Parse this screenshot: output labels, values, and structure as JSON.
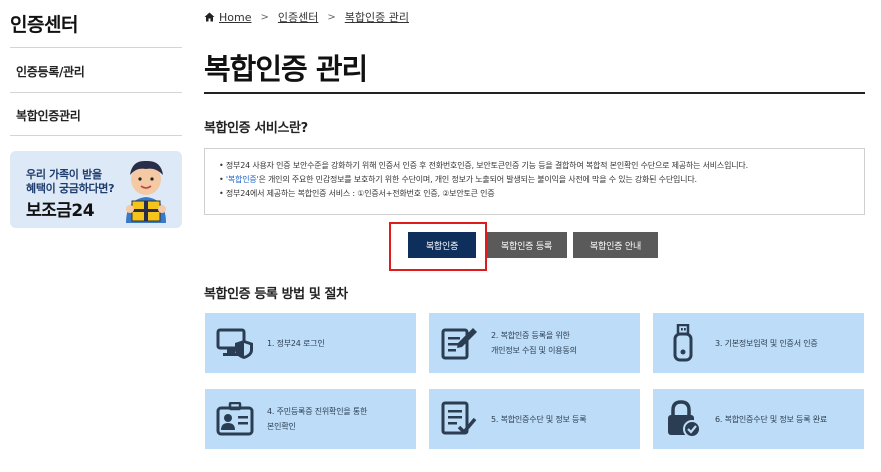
{
  "sidebar": {
    "title": "인증센터",
    "items": [
      {
        "label": "인증등록/관리"
      },
      {
        "label": "복합인증관리"
      }
    ],
    "banner": {
      "line1": "우리 가족이 받을",
      "line2": "혜택이 궁금하다면?",
      "brand": "보조금24"
    }
  },
  "breadcrumb": {
    "home": "Home",
    "level1": "인증센터",
    "level2": "복합인증 관리"
  },
  "page_title": "복합인증 관리",
  "service_section": {
    "title": "복합인증 서비스란?",
    "bullets": [
      {
        "pre": "",
        "highlight": "",
        "text": "정부24 사용자 인증 보안수준을 강화하기 위해 인증서 인증 후 전화번호인증, 보안토큰인증 기능 등을 결합하여 복합적 본인확인 수단으로 제공하는 서비스입니다."
      },
      {
        "pre": "",
        "highlight": "'복합인증'",
        "text": "은 개인의 주요한 민감정보를 보호하기 위한 수단이며, 개인 정보가 노출되어 발생되는 불이익을 사전에 막을 수 있는 강화된 수단입니다."
      },
      {
        "pre": "",
        "highlight": "",
        "text": "정부24에서 제공하는 복합인증 서비스 : ①인증서+전화번호 인증, ②보안토큰 인증"
      }
    ]
  },
  "buttons": {
    "primary": "복합인증",
    "register": "복합인증 등록",
    "guide": "복합인증 안내"
  },
  "procedure_section": {
    "title": "복합인증 등록 방법 및 절차",
    "steps": [
      {
        "line1": "1. 정부24 로그인",
        "line2": "",
        "icon": "monitor-shield-icon"
      },
      {
        "line1": "2. 복합인증 등록을 위한",
        "line2": "개인정보 수집 및 이용동의",
        "icon": "document-edit-icon"
      },
      {
        "line1": "3. 기본정보입력 및 인증서 인증",
        "line2": "",
        "icon": "usb-token-icon"
      },
      {
        "line1": "4. 주민등록증 진위확인을 통한",
        "line2": "본인확인",
        "icon": "id-card-icon"
      },
      {
        "line1": "5. 복합인증수단 및 정보 등록",
        "line2": "",
        "icon": "checklist-icon"
      },
      {
        "line1": "6. 복합인증수단 및 정보 등록 완료",
        "line2": "",
        "icon": "lock-check-icon"
      }
    ]
  },
  "colors": {
    "primary_button": "#0e2f5c",
    "secondary_button": "#5a5a5a",
    "step_card": "#bddcf7",
    "highlight_outline": "#e01b1b",
    "link_highlight": "#1a62c9"
  }
}
